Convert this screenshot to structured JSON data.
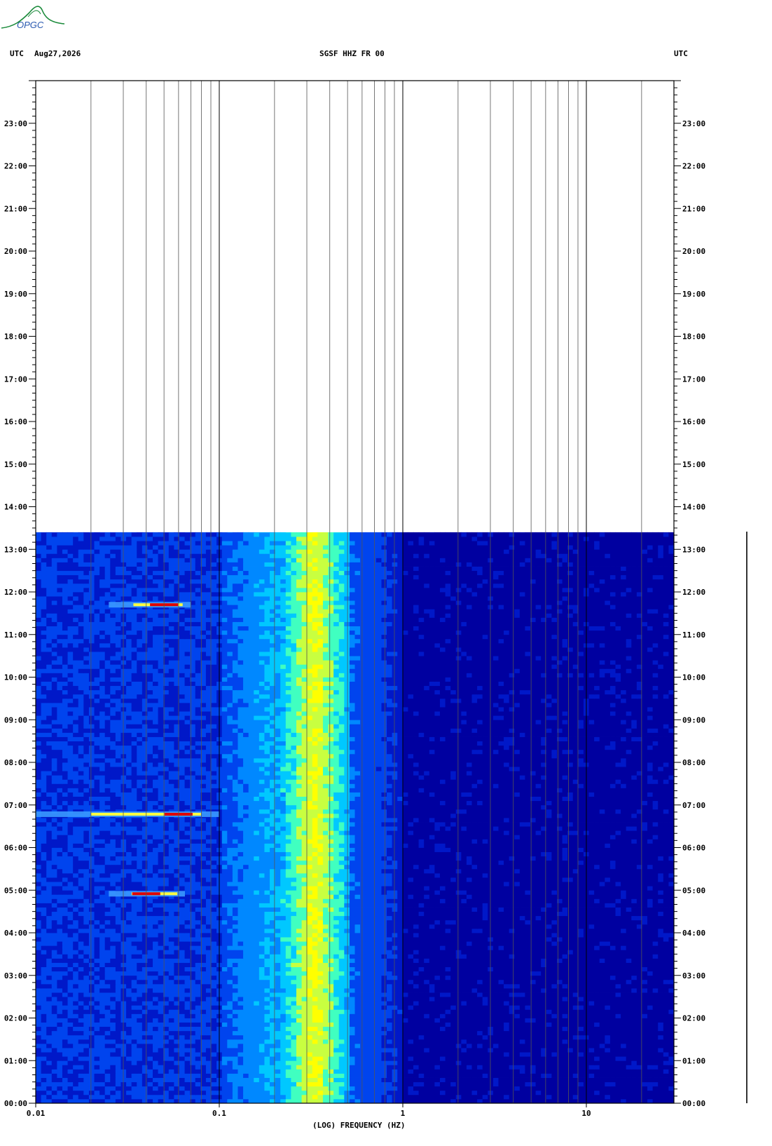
{
  "header": {
    "left_tz": "UTC",
    "date": "Aug27,2026",
    "station": "SGSF HHZ FR 00",
    "right_tz": "UTC"
  },
  "logo": {
    "text": "OPGC",
    "icon": "opgc-logo-icon"
  },
  "chart_data": {
    "type": "heatmap",
    "title": "SGSF HHZ FR 00",
    "xlabel": "(LOG) FREQUENCY (HZ)",
    "ylabel": "",
    "x_scale": "log",
    "xlim": [
      0.01,
      30
    ],
    "x_tick_labels": [
      "0.01",
      "0.1",
      "1",
      "10"
    ],
    "x_ticks": [
      0.01,
      0.1,
      1,
      10
    ],
    "ylim_hours": [
      0,
      24
    ],
    "y_tick_labels": [
      "00:00",
      "01:00",
      "02:00",
      "03:00",
      "04:00",
      "05:00",
      "06:00",
      "07:00",
      "08:00",
      "09:00",
      "10:00",
      "11:00",
      "12:00",
      "13:00",
      "14:00",
      "15:00",
      "16:00",
      "17:00",
      "18:00",
      "19:00",
      "20:00",
      "21:00",
      "22:00",
      "23:00"
    ],
    "data_end_hour": 13.4,
    "grid": true,
    "colormap": [
      "#0000a0",
      "#0018c8",
      "#0044ee",
      "#0088ff",
      "#00c8ff",
      "#40ffc0",
      "#c8ff40",
      "#ffff00",
      "#ff9000",
      "#e00000"
    ],
    "microseism_band_hz": [
      0.2,
      0.5
    ],
    "microseism_peak_hz": 0.33,
    "events": [
      {
        "time": "06:47",
        "freq_range_hz": [
          0.01,
          0.1
        ],
        "peak_hz": 0.06
      },
      {
        "time": "11:42",
        "freq_range_hz": [
          0.025,
          0.07
        ],
        "peak_hz": 0.05
      },
      {
        "time": "04:55",
        "freq_range_hz": [
          0.025,
          0.065
        ],
        "peak_hz": 0.04
      }
    ]
  }
}
